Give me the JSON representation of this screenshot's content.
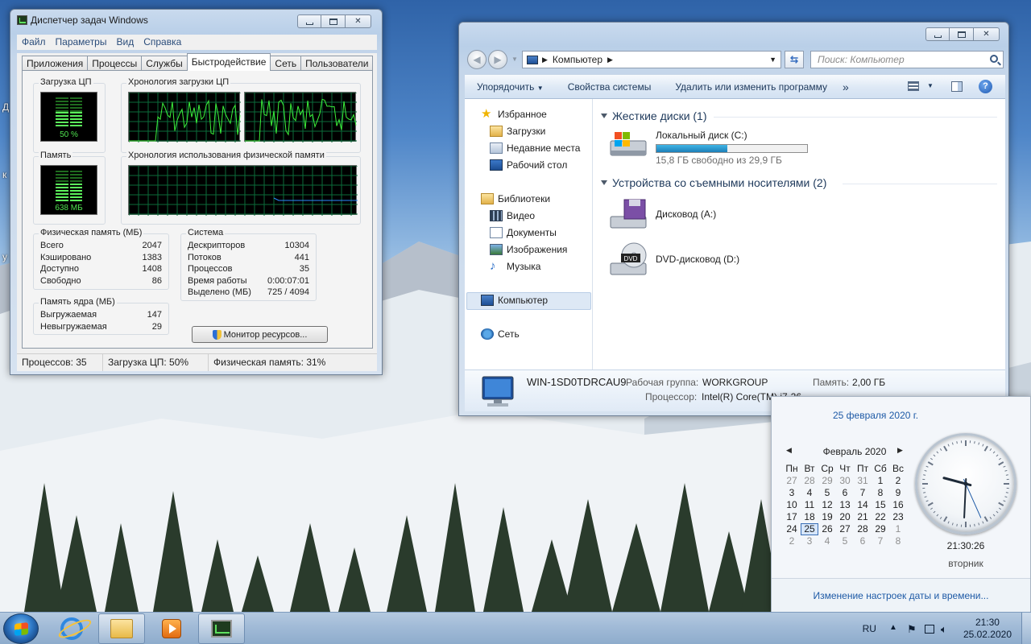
{
  "desktop": {
    "side_letters": [
      "Д",
      "к",
      "у"
    ]
  },
  "task_manager": {
    "title": "Диспетчер задач Windows",
    "menu": [
      "Файл",
      "Параметры",
      "Вид",
      "Справка"
    ],
    "tabs": [
      "Приложения",
      "Процессы",
      "Службы",
      "Быстродействие",
      "Сеть",
      "Пользователи"
    ],
    "active_tab": "Быстродействие",
    "cpu": {
      "title": "Загрузка ЦП",
      "value": "50 %",
      "level": 0.5,
      "history_title": "Хронология загрузки ЦП"
    },
    "memory": {
      "title": "Память",
      "value": "638 МБ",
      "level": 0.31,
      "history_title": "Хронология использования физической памяти"
    },
    "physical": {
      "title": "Физическая память (МБ)",
      "rows": [
        {
          "label": "Всего",
          "value": "2047"
        },
        {
          "label": "Кэшировано",
          "value": "1383"
        },
        {
          "label": "Доступно",
          "value": "1408"
        },
        {
          "label": "Свободно",
          "value": "86"
        }
      ]
    },
    "kernel": {
      "title": "Память ядра (МБ)",
      "rows": [
        {
          "label": "Выгружаемая",
          "value": "147"
        },
        {
          "label": "Невыгружаемая",
          "value": "29"
        }
      ]
    },
    "system": {
      "title": "Система",
      "rows": [
        {
          "label": "Дескрипторов",
          "value": "10304"
        },
        {
          "label": "Потоков",
          "value": "441"
        },
        {
          "label": "Процессов",
          "value": "35"
        },
        {
          "label": "Время работы",
          "value": "0:00:07:01"
        },
        {
          "label": "Выделено (МБ)",
          "value": "725 / 4094"
        }
      ]
    },
    "resource_monitor_button": "Монитор ресурсов...",
    "status": {
      "processes": "Процессов: 35",
      "cpu": "Загрузка ЦП: 50%",
      "memory": "Физическая память: 31%"
    }
  },
  "explorer": {
    "address": "Компьютер",
    "search_placeholder": "Поиск: Компьютер",
    "commands": [
      "Упорядочить",
      "Свойства системы",
      "Удалить или изменить программу"
    ],
    "more": "»",
    "sidebar": {
      "favorites": "Избранное",
      "favorites_items": [
        "Загрузки",
        "Недавние места",
        "Рабочий стол"
      ],
      "libraries": "Библиотеки",
      "libraries_items": [
        "Видео",
        "Документы",
        "Изображения",
        "Музыка"
      ],
      "computer": "Компьютер",
      "network": "Сеть"
    },
    "hard_disks_header": "Жесткие диски (1)",
    "local_disk": {
      "name": "Локальный диск (C:)",
      "free": "15,8 ГБ свободно из 29,9 ГБ",
      "used_fraction": 0.47
    },
    "removable_header": "Устройства со съемными носителями (2)",
    "floppy": "Дисковод (A:)",
    "dvd": "DVD-дисковод (D:)",
    "dvd_badge": "DVD",
    "info": {
      "computer_name": "WIN-1SD0TDRCAU9",
      "workgroup_label": "Рабочая группа:",
      "workgroup": "WORKGROUP",
      "memory_label": "Память:",
      "memory": "2,00 ГБ",
      "processor_label": "Процессор:",
      "processor": "Intel(R) Core(TM) i7-26"
    }
  },
  "calendar": {
    "full_date": "25 февраля 2020 г.",
    "month": "Февраль 2020",
    "weekdays": [
      "Пн",
      "Вт",
      "Ср",
      "Чт",
      "Пт",
      "Сб",
      "Вс"
    ],
    "days": [
      "27",
      "28",
      "29",
      "30",
      "31",
      "1",
      "2",
      "3",
      "4",
      "5",
      "6",
      "7",
      "8",
      "9",
      "10",
      "11",
      "12",
      "13",
      "14",
      "15",
      "16",
      "17",
      "18",
      "19",
      "20",
      "21",
      "22",
      "23",
      "24",
      "25",
      "26",
      "27",
      "28",
      "29",
      "1",
      "2",
      "3",
      "4",
      "5",
      "6",
      "7",
      "8"
    ],
    "today": "25",
    "time": "21:30:26",
    "weekday": "вторник",
    "clock": {
      "hours": 21,
      "minutes": 30,
      "seconds": 26
    },
    "link": "Изменение настроек даты и времени..."
  },
  "taskbar": {
    "language": "RU",
    "time": "21:30",
    "date": "25.02.2020"
  }
}
